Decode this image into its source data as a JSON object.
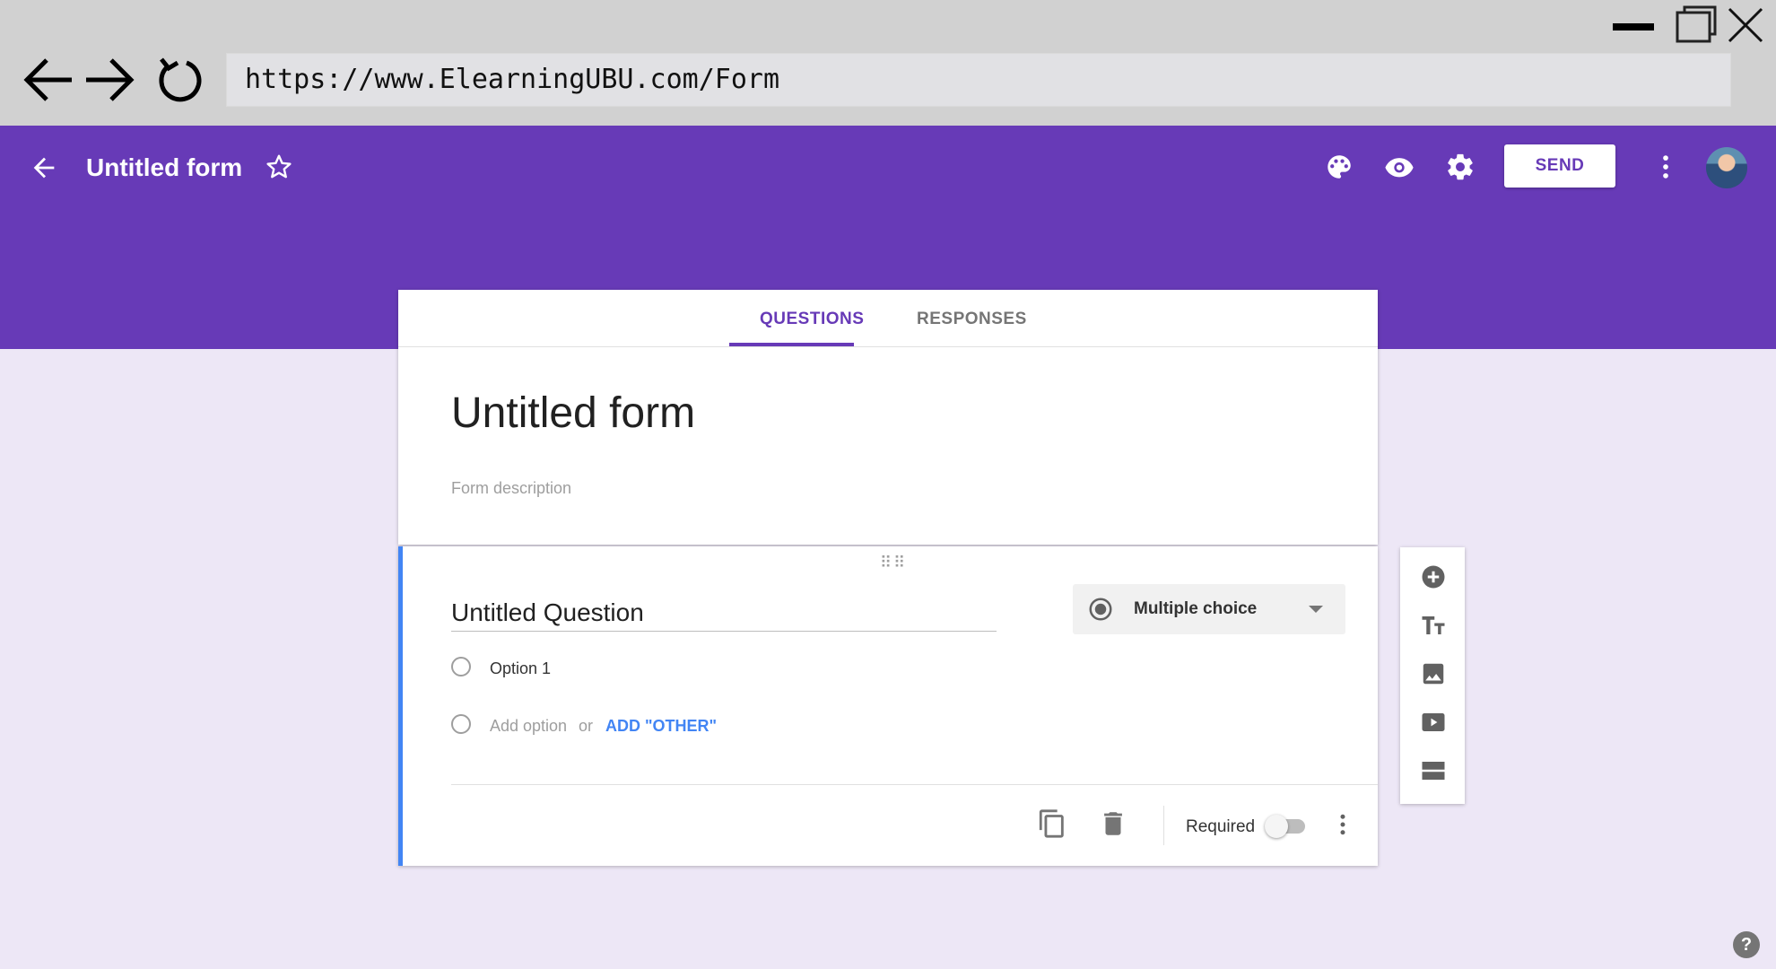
{
  "browser": {
    "url": "https://www.ElearningUBU.com/Form",
    "icons": [
      "back-arrow-icon",
      "forward-arrow-icon",
      "reload-icon",
      "minimize-icon",
      "maximize-icon",
      "close-icon"
    ]
  },
  "header": {
    "title": "Untitled form",
    "send_label": "SEND",
    "icons": [
      "back-icon",
      "star-icon",
      "palette-icon",
      "preview-eye-icon",
      "settings-gear-icon",
      "more-vert-icon",
      "avatar"
    ],
    "colors": {
      "brand": "#673ab7",
      "background": "#ede7f6"
    }
  },
  "tabs": [
    {
      "label": "QUESTIONS",
      "active": true
    },
    {
      "label": "RESPONSES",
      "active": false
    }
  ],
  "form": {
    "title": "Untitled form",
    "description_placeholder": "Form description"
  },
  "question": {
    "title": "Untitled Question",
    "type": "Multiple choice",
    "options": [
      "Option 1"
    ],
    "add_option": "Add option",
    "or_text": "or",
    "add_other": "ADD \"OTHER\"",
    "required_label": "Required",
    "required": false,
    "accent_color": "#4285f4"
  },
  "toolbar": {
    "icons": [
      "add-question-icon",
      "add-title-text-icon",
      "add-image-icon",
      "add-video-icon",
      "add-section-icon"
    ]
  },
  "help": "?"
}
